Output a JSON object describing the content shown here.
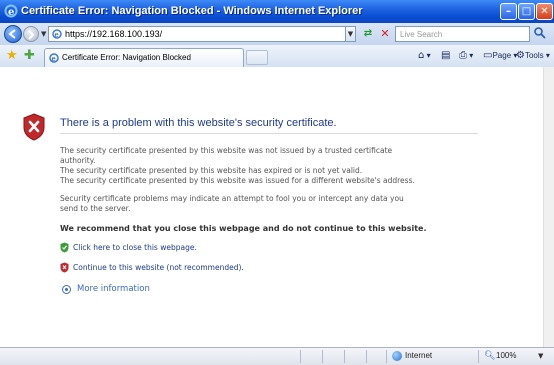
{
  "window": {
    "title": "Certificate Error: Navigation Blocked - Windows Internet Explorer",
    "minimize_glyph": "–",
    "maximize_glyph": "□",
    "close_glyph": "✕"
  },
  "address_bar": {
    "url": "https://192.168.100.193/",
    "refresh_glyph": "⇄",
    "stop_glyph": "✕",
    "search_placeholder": "Live Search",
    "search_glyph": "⌕"
  },
  "tab": {
    "label": "Certificate Error: Navigation Blocked"
  },
  "command_bar": {
    "home_glyph": "⌂",
    "feeds_glyph": "▤",
    "print_glyph": "⎙",
    "page_label": "Page",
    "tools_label": "Tools"
  },
  "content": {
    "heading": "There is a problem with this website's security certificate.",
    "para1_line1": "The security certificate presented by this website was not issued by a trusted certificate",
    "para1_line2": "authority.",
    "para1_line3": "The security certificate presented by this website has expired or is not yet valid.",
    "para1_line4": "The security certificate presented by this website was issued for a different website's address.",
    "para2_line1": "Security certificate problems may indicate an attempt to fool you or intercept any data you",
    "para2_line2": "send to the server.",
    "recommendation": "We recommend that you close this webpage and do not continue to this website.",
    "close_link": "Click here to close this webpage.",
    "continue_link": "Continue to this website (not recommended).",
    "more_info": "More information"
  },
  "status_bar": {
    "zone": "Internet",
    "zoom": "100%"
  },
  "colors": {
    "heading": "#1f3a8a",
    "link": "#1f3a8a",
    "more_info": "#3a69c8",
    "shield_error": "#c0282b",
    "shield_safe": "#3f9a3a",
    "titlebar": "#0a4fd4"
  },
  "icons": {
    "title": "ie-logo-icon",
    "error": "shield-x-icon",
    "close_option": "green-shield-icon",
    "continue_option": "red-shield-icon",
    "more_info": "radio-expand-icon"
  }
}
